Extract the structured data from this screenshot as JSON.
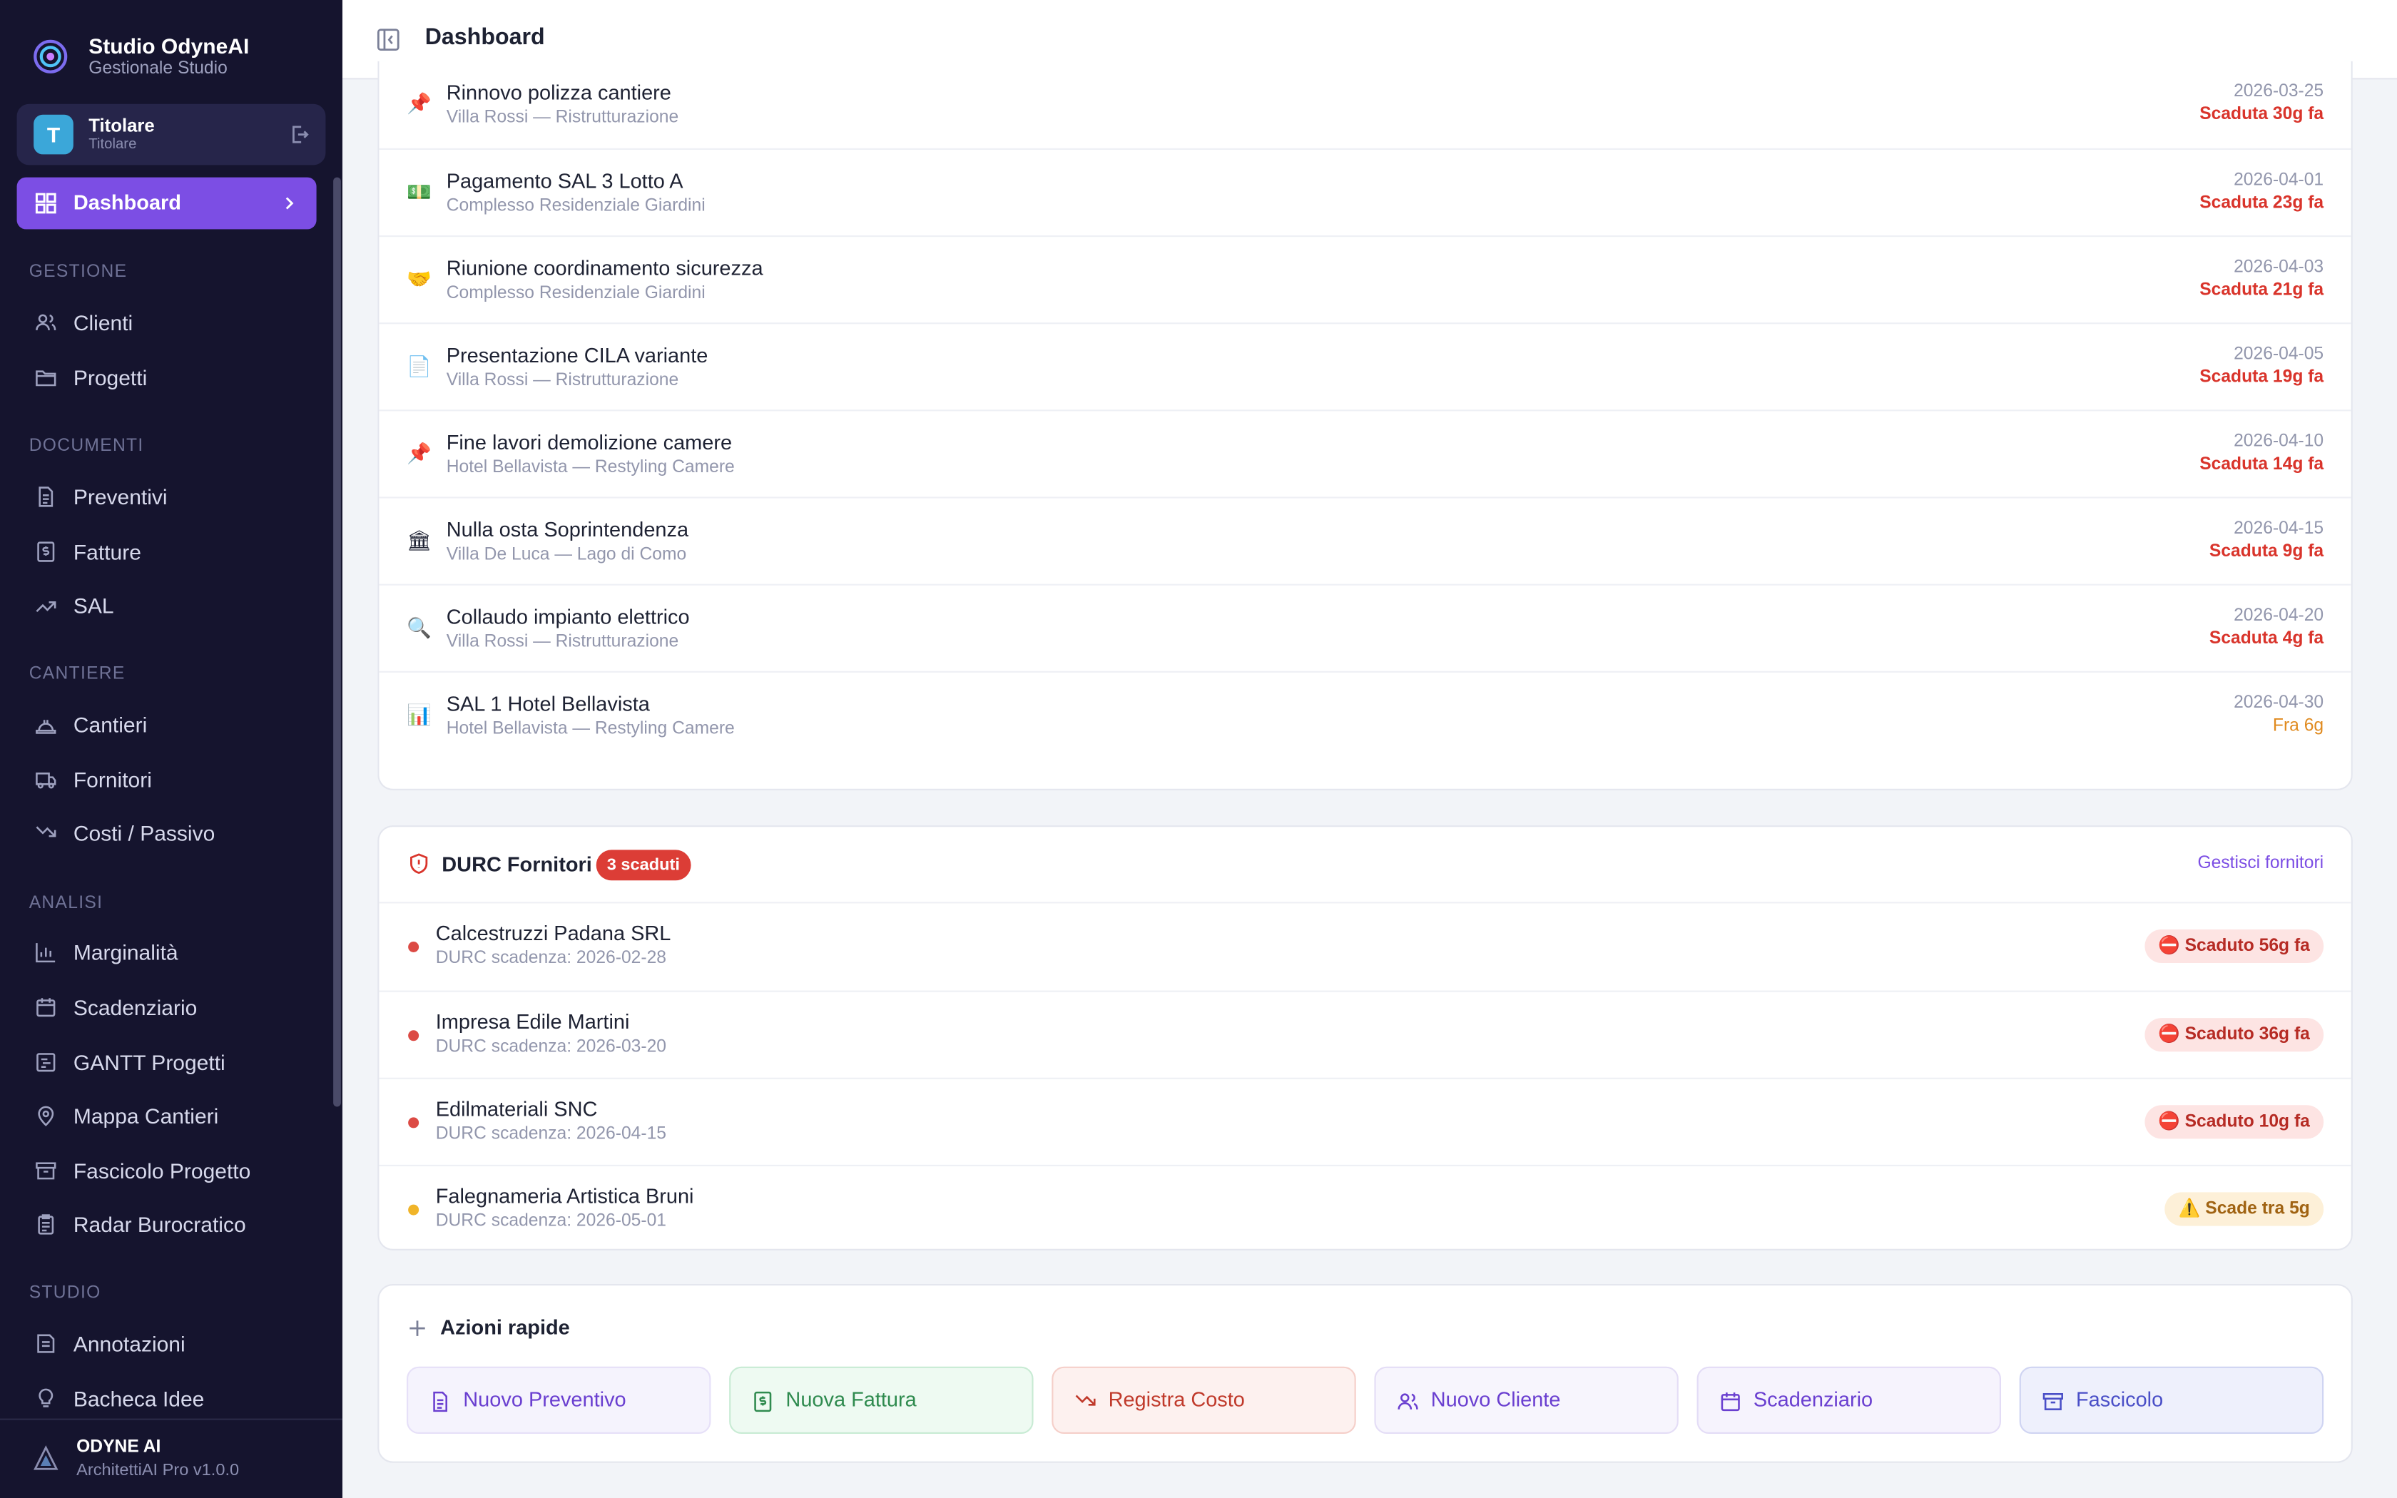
{
  "app": {
    "name": "Studio OdyneAI",
    "subtitle": "Gestionale Studio"
  },
  "user": {
    "initial": "T",
    "name": "Titolare",
    "role": "Titolare"
  },
  "nav": {
    "active": {
      "label": "Dashboard",
      "icon": "grid-icon"
    },
    "sections": [
      {
        "title": "GESTIONE",
        "items": [
          {
            "label": "Clienti",
            "icon": "users-icon"
          },
          {
            "label": "Progetti",
            "icon": "folder-icon"
          }
        ]
      },
      {
        "title": "DOCUMENTI",
        "items": [
          {
            "label": "Preventivi",
            "icon": "file-text-icon"
          },
          {
            "label": "Fatture",
            "icon": "invoice-icon"
          },
          {
            "label": "SAL",
            "icon": "trending-up-icon"
          }
        ]
      },
      {
        "title": "CANTIERE",
        "items": [
          {
            "label": "Cantieri",
            "icon": "hard-hat-icon"
          },
          {
            "label": "Fornitori",
            "icon": "truck-icon"
          },
          {
            "label": "Costi / Passivo",
            "icon": "trending-down-icon"
          }
        ]
      },
      {
        "title": "ANALISI",
        "items": [
          {
            "label": "Marginalità",
            "icon": "bar-chart-icon"
          },
          {
            "label": "Scadenziario",
            "icon": "calendar-icon"
          },
          {
            "label": "GANTT Progetti",
            "icon": "gantt-icon"
          },
          {
            "label": "Mappa Cantieri",
            "icon": "map-pin-icon"
          },
          {
            "label": "Fascicolo Progetto",
            "icon": "archive-icon"
          },
          {
            "label": "Radar Burocratico",
            "icon": "clipboard-icon"
          }
        ]
      },
      {
        "title": "STUDIO",
        "items": [
          {
            "label": "Annotazioni",
            "icon": "note-icon"
          },
          {
            "label": "Bacheca Idee",
            "icon": "lightbulb-icon"
          }
        ]
      }
    ]
  },
  "footer": {
    "title": "ODYNE AI",
    "version": "ArchitettiAI Pro v1.0.0"
  },
  "header": {
    "title": "Dashboard"
  },
  "deadlines": [
    {
      "icon": "pushpin-icon",
      "glyph": "📌",
      "title": "Rinnovo polizza cantiere",
      "project": "Villa Rossi — Ristrutturazione",
      "date": "2026-03-25",
      "status": "Scaduta 30g fa",
      "kind": "overdue"
    },
    {
      "icon": "money-icon",
      "glyph": "💵",
      "title": "Pagamento SAL 3 Lotto A",
      "project": "Complesso Residenziale Giardini",
      "date": "2026-04-01",
      "status": "Scaduta 23g fa",
      "kind": "overdue"
    },
    {
      "icon": "handshake-icon",
      "glyph": "🤝",
      "title": "Riunione coordinamento sicurezza",
      "project": "Complesso Residenziale Giardini",
      "date": "2026-04-03",
      "status": "Scaduta 21g fa",
      "kind": "overdue"
    },
    {
      "icon": "document-icon",
      "glyph": "📄",
      "title": "Presentazione CILA variante",
      "project": "Villa Rossi — Ristrutturazione",
      "date": "2026-04-05",
      "status": "Scaduta 19g fa",
      "kind": "overdue"
    },
    {
      "icon": "pushpin-icon",
      "glyph": "📌",
      "title": "Fine lavori demolizione camere",
      "project": "Hotel Bellavista — Restyling Camere",
      "date": "2026-04-10",
      "status": "Scaduta 14g fa",
      "kind": "overdue"
    },
    {
      "icon": "government-building-icon",
      "glyph": "🏛",
      "title": "Nulla osta Soprintendenza",
      "project": "Villa De Luca — Lago di Como",
      "date": "2026-04-15",
      "status": "Scaduta 9g fa",
      "kind": "overdue"
    },
    {
      "icon": "magnifier-icon",
      "glyph": "🔍",
      "title": "Collaudo impianto elettrico",
      "project": "Villa Rossi — Ristrutturazione",
      "date": "2026-04-20",
      "status": "Scaduta 4g fa",
      "kind": "overdue"
    },
    {
      "icon": "bar-chart-emoji-icon",
      "glyph": "📊",
      "title": "SAL 1 Hotel Bellavista",
      "project": "Hotel Bellavista — Restyling Camere",
      "date": "2026-04-30",
      "status": "Fra 6g",
      "kind": "soon"
    }
  ],
  "durc": {
    "title": "DURC Fornitori",
    "badge": "3 scaduti",
    "link": "Gestisci fornitori",
    "items": [
      {
        "name": "Calcestruzzi Padana SRL",
        "date": "DURC scadenza: 2026-02-28",
        "status": "⛔ Scaduto 56g fa",
        "kind": "expired",
        "dot": "#dc4a44"
      },
      {
        "name": "Impresa Edile Martini",
        "date": "DURC scadenza: 2026-03-20",
        "status": "⛔ Scaduto 36g fa",
        "kind": "expired",
        "dot": "#dc4a44"
      },
      {
        "name": "Edilmateriali SNC",
        "date": "DURC scadenza: 2026-04-15",
        "status": "⛔ Scaduto 10g fa",
        "kind": "expired",
        "dot": "#dc4a44"
      },
      {
        "name": "Falegnameria Artistica Bruni",
        "date": "DURC scadenza: 2026-05-01",
        "status": "⚠️ Scade tra 5g",
        "kind": "warn",
        "dot": "#f0b429"
      }
    ]
  },
  "quick_actions": {
    "title": "Azioni rapide",
    "buttons": [
      {
        "label": "Nuovo Preventivo",
        "icon": "file-text-icon",
        "bg": "#f5f3fd",
        "border": "#e6e0f8",
        "color": "#6a3fd0"
      },
      {
        "label": "Nuova Fattura",
        "icon": "invoice-icon",
        "bg": "#eefaf2",
        "border": "#c8ebd4",
        "color": "#2f8b4f"
      },
      {
        "label": "Registra Costo",
        "icon": "trending-down-icon",
        "bg": "#fdf1ef",
        "border": "#f5cfc9",
        "color": "#c03a2b"
      },
      {
        "label": "Nuovo Cliente",
        "icon": "users-icon",
        "bg": "#f7f5fd",
        "border": "#e4ddf6",
        "color": "#6a3fd0"
      },
      {
        "label": "Scadenziario",
        "icon": "calendar-icon",
        "bg": "#f6f3fd",
        "border": "#e3dcf6",
        "color": "#6a3fd0"
      },
      {
        "label": "Fascicolo",
        "icon": "archive-icon",
        "bg": "#eef0fc",
        "border": "#cfd4f2",
        "color": "#4a4fc7"
      }
    ]
  }
}
